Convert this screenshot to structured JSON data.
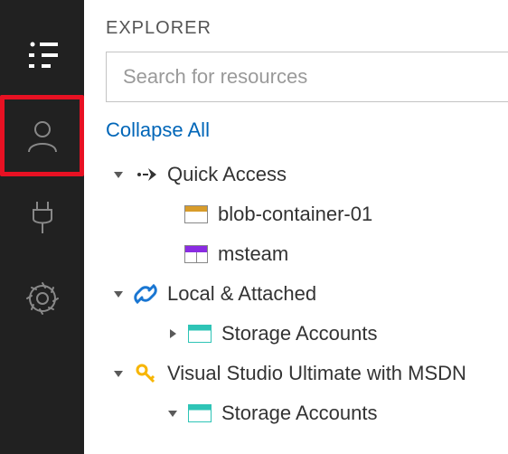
{
  "sidebar": {
    "items": [
      {
        "name": "explorer",
        "active": true
      },
      {
        "name": "account",
        "highlighted": true
      },
      {
        "name": "connect"
      },
      {
        "name": "settings"
      }
    ]
  },
  "header": {
    "title": "EXPLORER"
  },
  "search": {
    "placeholder": "Search for resources",
    "value": ""
  },
  "actions": {
    "collapse_all": "Collapse All"
  },
  "tree": [
    {
      "id": "quick-access",
      "label": "Quick Access",
      "icon": "quick-access-icon",
      "expanded": true,
      "children": [
        {
          "id": "blob-container-01",
          "label": "blob-container-01",
          "icon": "blob-container-icon"
        },
        {
          "id": "msteam",
          "label": "msteam",
          "icon": "table-icon"
        }
      ]
    },
    {
      "id": "local-attached",
      "label": "Local & Attached",
      "icon": "link-icon",
      "expanded": true,
      "children": [
        {
          "id": "local-storage-accounts",
          "label": "Storage Accounts",
          "icon": "storage-icon",
          "expanded": false
        }
      ]
    },
    {
      "id": "vs-ultimate-msdn",
      "label": "Visual Studio Ultimate with MSDN",
      "icon": "key-icon",
      "expanded": true,
      "children": [
        {
          "id": "msdn-storage-accounts",
          "label": "Storage Accounts",
          "icon": "storage-icon",
          "expanded": true
        }
      ]
    }
  ]
}
